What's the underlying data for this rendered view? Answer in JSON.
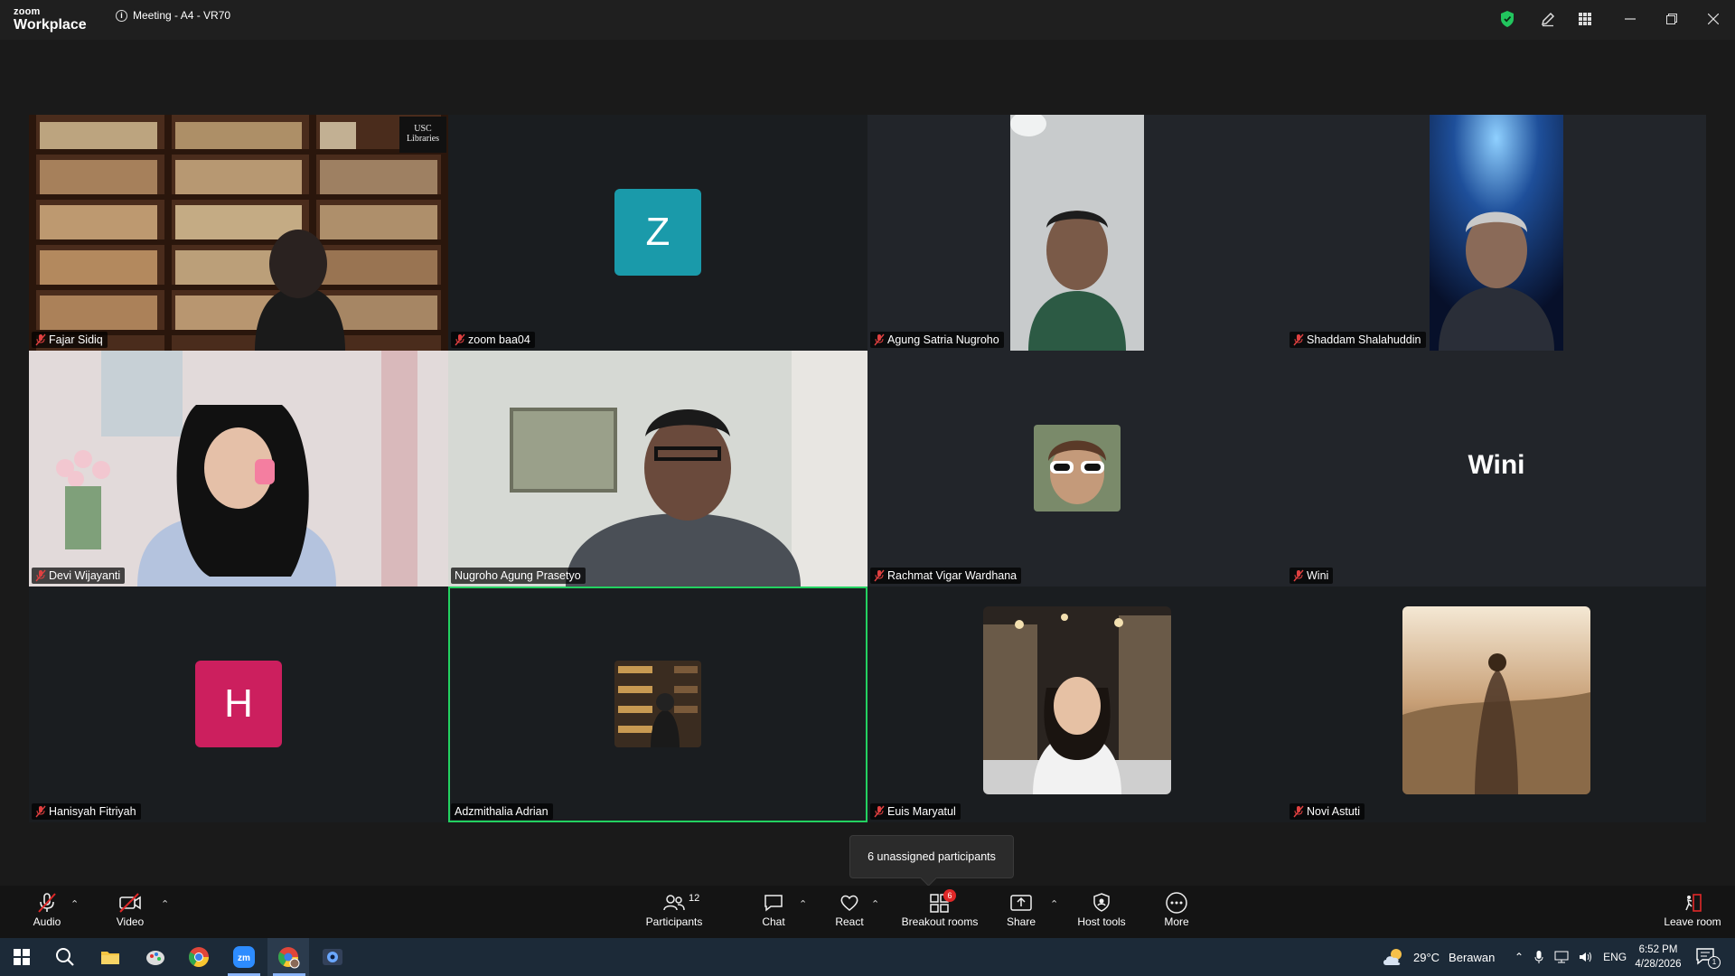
{
  "window": {
    "logo_top": "zoom",
    "logo_bottom": "Workplace",
    "title": "Meeting - A4 - VR70"
  },
  "participants": [
    {
      "name": "Fajar Sidiq",
      "muted": true,
      "type": "video",
      "overlay": "USC Libraries"
    },
    {
      "name": "zoom baa04",
      "muted": true,
      "type": "letter",
      "letter": "Z",
      "color": "#1a9aaa"
    },
    {
      "name": "Agung Satria Nugroho",
      "muted": true,
      "type": "video"
    },
    {
      "name": "Shaddam Shalahuddin",
      "muted": true,
      "type": "video"
    },
    {
      "name": "Devi Wijayanti",
      "muted": true,
      "type": "video"
    },
    {
      "name": "Nugroho Agung Prasetyo",
      "muted": false,
      "type": "video"
    },
    {
      "name": "Rachmat Vigar Wardhana",
      "muted": true,
      "type": "photo"
    },
    {
      "name": "Wini",
      "muted": true,
      "type": "name",
      "display": "Wini"
    },
    {
      "name": "Hanisyah Fitriyah",
      "muted": true,
      "type": "letter",
      "letter": "H",
      "color": "#cc1f5e"
    },
    {
      "name": "Adzmithalia Adrian",
      "muted": false,
      "type": "photo",
      "active": true
    },
    {
      "name": "Euis Maryatul",
      "muted": true,
      "type": "photo"
    },
    {
      "name": "Novi Astuti",
      "muted": true,
      "type": "photo"
    }
  ],
  "tooltip": "6 unassigned participants",
  "toolbar": {
    "audio": "Audio",
    "video": "Video",
    "participants": "Participants",
    "participants_count": "12",
    "chat": "Chat",
    "react": "React",
    "breakout": "Breakout rooms",
    "breakout_badge": "6",
    "share": "Share",
    "host_tools": "Host tools",
    "more": "More",
    "leave": "Leave room"
  },
  "taskbar": {
    "weather_temp": "29°C",
    "weather_desc": "Berawan",
    "lang": "ENG",
    "time": "6:52 PM",
    "date": "4/28/2026",
    "notif_count": "1"
  },
  "colors": {
    "accent_green": "#23d160",
    "badge_red": "#e02828",
    "shield_green": "#22c55e"
  }
}
